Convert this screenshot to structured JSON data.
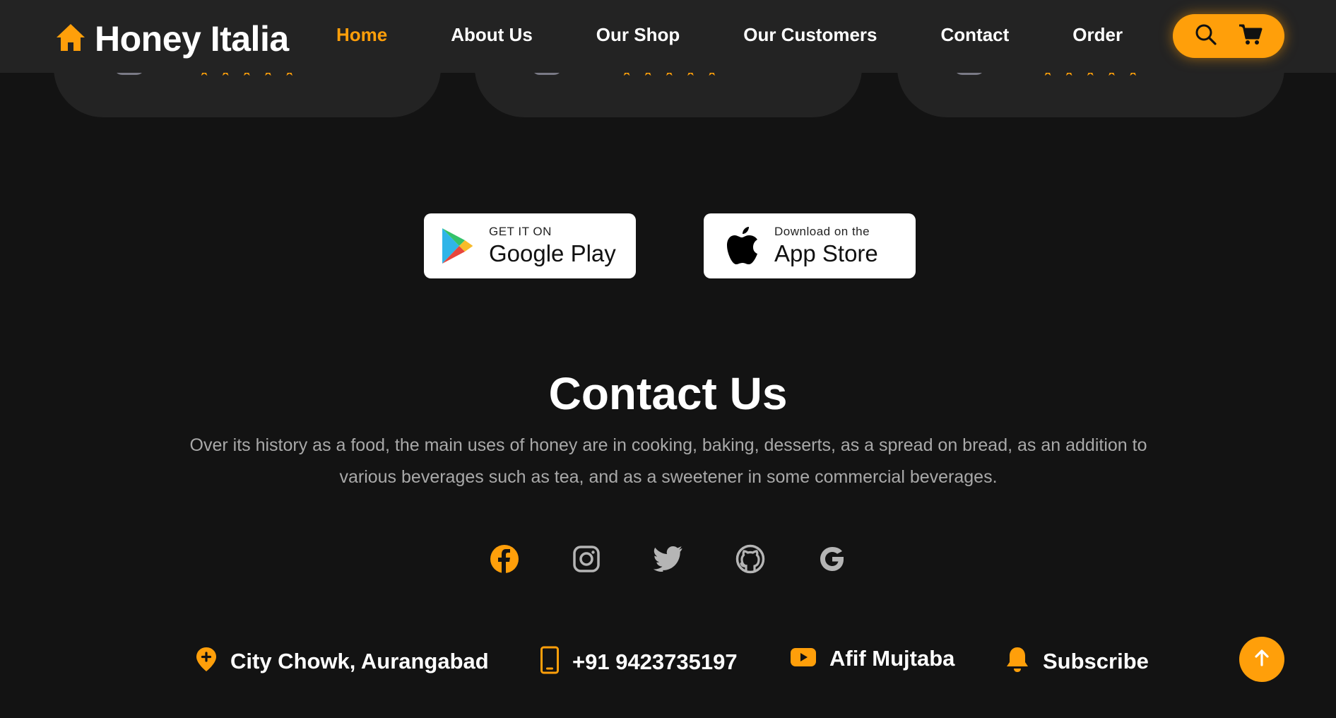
{
  "header": {
    "brand": "Honey Italia",
    "nav": [
      {
        "label": "Home",
        "active": true
      },
      {
        "label": "About Us",
        "active": false
      },
      {
        "label": "Our Shop",
        "active": false
      },
      {
        "label": "Our Customers",
        "active": false
      },
      {
        "label": "Contact",
        "active": false
      },
      {
        "label": "Order",
        "active": false
      }
    ],
    "actions": [
      "search-icon",
      "cart-icon"
    ]
  },
  "reviews": {
    "cards": [
      {
        "rating": 5
      },
      {
        "rating": 5
      },
      {
        "rating": 5
      }
    ]
  },
  "badges": {
    "google": {
      "small": "GET IT ON",
      "big": "Google Play"
    },
    "apple": {
      "small": "Download on the",
      "big": "App Store"
    }
  },
  "contact": {
    "title": "Contact Us",
    "description": "Over its history as a food, the main uses of honey are in cooking, baking, desserts, as a spread on bread, as an addition to various beverages such as tea, and as a sweetener in some commercial beverages."
  },
  "socials": [
    "facebook-icon",
    "instagram-icon",
    "twitter-icon",
    "github-icon",
    "google-icon"
  ],
  "info": {
    "location": "City Chowk, Aurangabad",
    "phone": "+91 9423735197",
    "youtube": "Afif Mujtaba",
    "subscribe": "Subscribe"
  },
  "colors": {
    "accent": "#ff9f0a",
    "background": "#131313",
    "surface": "#232323",
    "muted_text": "#a9a9a9"
  }
}
